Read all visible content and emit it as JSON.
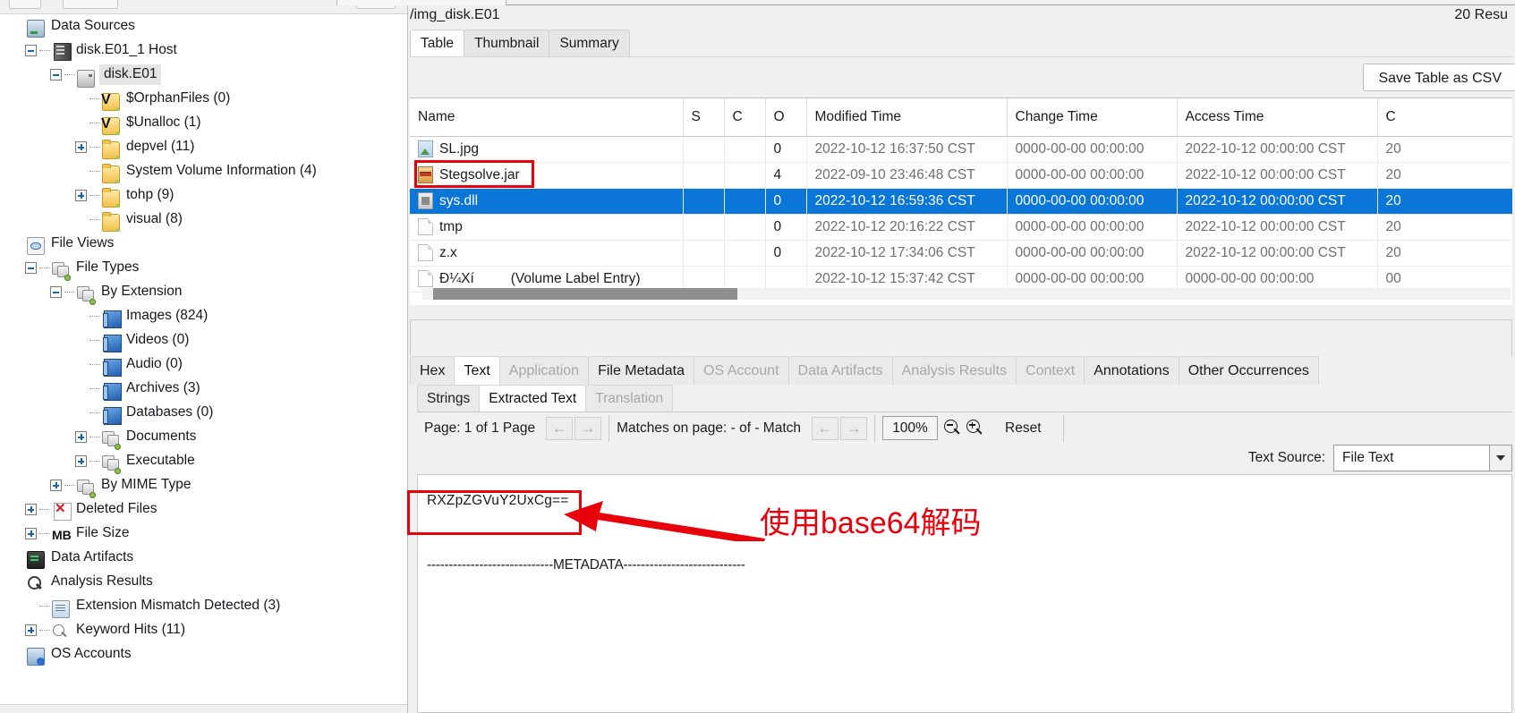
{
  "app": {
    "left_toolbar_buttons": [
      "",
      ""
    ]
  },
  "tree": {
    "title": "Data Sources",
    "nodes": [
      {
        "label": "Data Sources",
        "icon": "datasource-icon",
        "indent": 0,
        "twisty": "none",
        "dots": false
      },
      {
        "label": "disk.E01_1 Host",
        "icon": "host-icon",
        "indent": 1,
        "twisty": "minus",
        "dots": true
      },
      {
        "label": "disk.E01",
        "icon": "drive-icon",
        "indent": 2,
        "twisty": "minus",
        "dots": true,
        "selected": true
      },
      {
        "label": "$OrphanFiles (0)",
        "icon": "folder-orphan-icon",
        "indent": 3,
        "twisty": "none",
        "dots": true
      },
      {
        "label": "$Unalloc (1)",
        "icon": "folder-orphan-icon",
        "indent": 3,
        "twisty": "none",
        "dots": true
      },
      {
        "label": "depvel (11)",
        "icon": "folder-icon",
        "indent": 3,
        "twisty": "plus",
        "dots": true
      },
      {
        "label": "System Volume Information (4)",
        "icon": "folder-icon",
        "indent": 3,
        "twisty": "none",
        "dots": true
      },
      {
        "label": "tohp (9)",
        "icon": "folder-icon",
        "indent": 3,
        "twisty": "plus",
        "dots": true
      },
      {
        "label": "visual (8)",
        "icon": "folder-icon",
        "indent": 3,
        "twisty": "none",
        "dots": true
      },
      {
        "label": "File Views",
        "icon": "file-views-icon",
        "indent": 0,
        "twisty": "none",
        "dots": false
      },
      {
        "label": "File Types",
        "icon": "file-type-icon",
        "indent": 1,
        "twisty": "minus",
        "dots": true
      },
      {
        "label": "By Extension",
        "icon": "file-type-icon",
        "indent": 2,
        "twisty": "minus",
        "dots": true
      },
      {
        "label": "Images (824)",
        "icon": "blue-file-icon",
        "indent": 3,
        "twisty": "none",
        "dots": true
      },
      {
        "label": "Videos (0)",
        "icon": "blue-file-icon",
        "indent": 3,
        "twisty": "none",
        "dots": true
      },
      {
        "label": "Audio (0)",
        "icon": "blue-file-icon",
        "indent": 3,
        "twisty": "none",
        "dots": true
      },
      {
        "label": "Archives (3)",
        "icon": "blue-file-icon",
        "indent": 3,
        "twisty": "none",
        "dots": true
      },
      {
        "label": "Databases (0)",
        "icon": "blue-file-icon",
        "indent": 3,
        "twisty": "none",
        "dots": true
      },
      {
        "label": "Documents",
        "icon": "file-type-icon",
        "indent": 3,
        "twisty": "plus",
        "dots": true
      },
      {
        "label": "Executable",
        "icon": "file-type-icon",
        "indent": 3,
        "twisty": "plus",
        "dots": true
      },
      {
        "label": "By MIME Type",
        "icon": "file-type-icon",
        "indent": 2,
        "twisty": "plus",
        "dots": true
      },
      {
        "label": "Deleted Files",
        "icon": "deleted-file-icon",
        "indent": 1,
        "twisty": "plus",
        "dots": true
      },
      {
        "label": "File Size",
        "icon": "mb-icon",
        "indent": 1,
        "twisty": "plus",
        "dots": true
      },
      {
        "label": "Data Artifacts",
        "icon": "data-artifact-icon",
        "indent": 0,
        "twisty": "none",
        "dots": false
      },
      {
        "label": "Analysis Results",
        "icon": "magnifier-icon",
        "indent": 0,
        "twisty": "none",
        "dots": false
      },
      {
        "label": "Extension Mismatch Detected (3)",
        "icon": "report-icon",
        "indent": 1,
        "twisty": "none",
        "dots": true
      },
      {
        "label": "Keyword Hits (11)",
        "icon": "magnifier-light-icon",
        "indent": 1,
        "twisty": "plus",
        "dots": true
      },
      {
        "label": "OS Accounts",
        "icon": "os-account-icon",
        "indent": 0,
        "twisty": "none",
        "dots": false
      }
    ]
  },
  "content": {
    "breadcrumb": "/img_disk.E01",
    "result_count": "20  Resu",
    "view_tabs": [
      {
        "label": "Table",
        "active": true
      },
      {
        "label": "Thumbnail",
        "active": false
      },
      {
        "label": "Summary",
        "active": false
      }
    ],
    "save_csv_label": "Save Table as CSV"
  },
  "file_table": {
    "columns": [
      "Name",
      "S",
      "C",
      "O",
      "Modified Time",
      "Change Time",
      "Access Time",
      "C"
    ],
    "rows": [
      {
        "name": "SL.jpg",
        "icon": "image-file-icon",
        "s": "",
        "c": "",
        "o": "0",
        "modified": "2022-10-12 16:37:50 CST",
        "change": "0000-00-00 00:00:00",
        "access": "2022-10-12 00:00:00 CST",
        "created": "20",
        "selected": false,
        "suffix": ""
      },
      {
        "name": "Stegsolve.jar",
        "icon": "jar-file-icon",
        "s": "",
        "c": "",
        "o": "4",
        "modified": "2022-09-10 23:46:48 CST",
        "change": "0000-00-00 00:00:00",
        "access": "2022-10-12 00:00:00 CST",
        "created": "20",
        "selected": false,
        "suffix": ""
      },
      {
        "name": "sys.dll",
        "icon": "dll-file-icon",
        "s": "",
        "c": "",
        "o": "0",
        "modified": "2022-10-12 16:59:36 CST",
        "change": "0000-00-00 00:00:00",
        "access": "2022-10-12 00:00:00 CST",
        "created": "20",
        "selected": true,
        "suffix": ""
      },
      {
        "name": "tmp",
        "icon": "doc-file-icon",
        "s": "",
        "c": "",
        "o": "0",
        "modified": "2022-10-12 20:16:22 CST",
        "change": "0000-00-00 00:00:00",
        "access": "2022-10-12 00:00:00 CST",
        "created": "20",
        "selected": false,
        "suffix": ""
      },
      {
        "name": "z.x",
        "icon": "doc-file-icon",
        "s": "",
        "c": "",
        "o": "0",
        "modified": "2022-10-12 17:34:06 CST",
        "change": "0000-00-00 00:00:00",
        "access": "2022-10-12 00:00:00 CST",
        "created": "20",
        "selected": false,
        "suffix": ""
      },
      {
        "name": "Ð¼Xí",
        "icon": "doc-file-icon",
        "s": "",
        "c": "",
        "o": "",
        "modified": "2022-10-12 15:37:42 CST",
        "change": "0000-00-00 00:00:00",
        "access": "0000-00-00 00:00:00",
        "created": "00",
        "selected": false,
        "suffix": "(Volume Label Entry)"
      }
    ]
  },
  "detail": {
    "tabs": [
      {
        "label": "Hex",
        "state": "enabled"
      },
      {
        "label": "Text",
        "state": "active"
      },
      {
        "label": "Application",
        "state": "disabled"
      },
      {
        "label": "File Metadata",
        "state": "enabled"
      },
      {
        "label": "OS Account",
        "state": "disabled"
      },
      {
        "label": "Data Artifacts",
        "state": "disabled"
      },
      {
        "label": "Analysis Results",
        "state": "disabled"
      },
      {
        "label": "Context",
        "state": "disabled"
      },
      {
        "label": "Annotations",
        "state": "enabled"
      },
      {
        "label": "Other Occurrences",
        "state": "enabled"
      }
    ],
    "sub_tabs": [
      {
        "label": "Strings",
        "state": "enabled"
      },
      {
        "label": "Extracted Text",
        "state": "active"
      },
      {
        "label": "Translation",
        "state": "disabled"
      }
    ],
    "nav": {
      "page_label": "Page: 1 of 1 Page",
      "prev_page_icon": "arrow-left-icon",
      "next_page_icon": "arrow-right-icon",
      "matches_label": "Matches on page:  -  of  -  Match",
      "prev_match_icon": "arrow-left-icon",
      "next_match_icon": "arrow-right-icon",
      "zoom_value": "100%",
      "zoom_out_icon": "magnifier-minus-icon",
      "zoom_in_icon": "magnifier-plus-icon",
      "reset_label": "Reset"
    },
    "text_source_label": "Text Source:",
    "text_source_value": "File Text",
    "content": {
      "base64": "RXZpZGVuY2UxCg==",
      "metadata_divider": "-----------------------------METADATA----------------------------"
    }
  },
  "annotations": {
    "note_text": "使用base64解码",
    "accent_color": "#e8000b"
  },
  "colors": {
    "selection_blue": "#0a76d8",
    "panel_gray": "#f0f0f0",
    "annotation_red": "#e8000b"
  }
}
